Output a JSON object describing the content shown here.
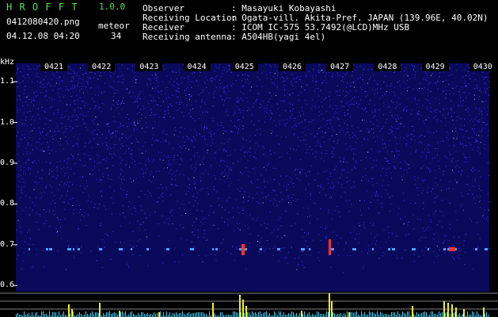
{
  "header": {
    "app_name": "H R O F F T",
    "version": "1.0.0",
    "filename": "0412080420.png",
    "datetime": "04.12.08 04:20",
    "meteor_label": "meteor",
    "meteor_count": "34",
    "info_labels": [
      "Observer",
      "Receiving Location",
      "Receiver",
      "Receiving antenna"
    ],
    "info_values": [
      ": Masayuki Kobayashi",
      ": Ogata-vill. Akita-Pref. JAPAN (139.96E, 40.02N)",
      ": ICOM IC-575 53.7492(@LCD)MHz USB",
      ": A504HB(yagi 4el)"
    ]
  },
  "axis": {
    "unit_label": "kHz",
    "y_ticks": [
      {
        "label": "1.1",
        "value": 1.1
      },
      {
        "label": "1.0",
        "value": 1.0
      },
      {
        "label": "0.9",
        "value": 0.9
      },
      {
        "label": "0.8",
        "value": 0.8
      },
      {
        "label": "0.7",
        "value": 0.7
      },
      {
        "label": "0.6",
        "value": 0.6
      }
    ],
    "time_ticks": [
      "0421",
      "0422",
      "0423",
      "0424",
      "0425",
      "0426",
      "0427",
      "0428",
      "0429",
      "0430"
    ]
  },
  "colors": {
    "header_green": "#52e052",
    "background": "#0a0a5c",
    "noise": "#3a3ae6",
    "echo": "#ff3030",
    "bar_yellow": "#f0f020",
    "bar_cyan": "#40d0ff"
  }
}
